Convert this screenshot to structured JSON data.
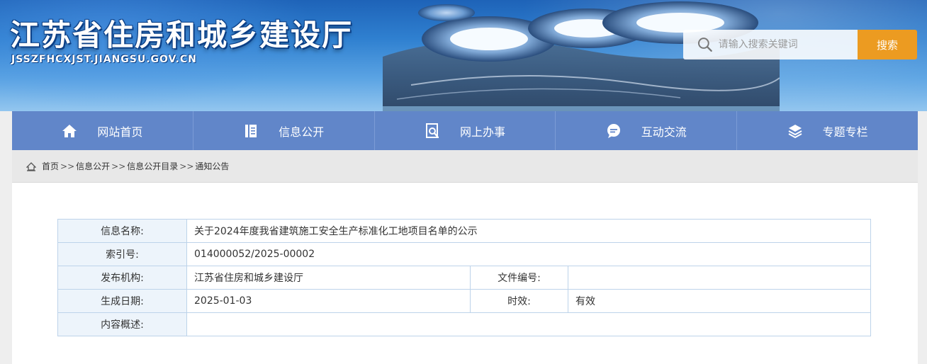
{
  "header": {
    "site_title": "江苏省住房和城乡建设厅",
    "site_url": "JSSZFHCXJST.JIANGSU.GOV.CN",
    "search": {
      "placeholder": "请输入搜索关键词",
      "button_label": "搜索"
    }
  },
  "nav": {
    "items": [
      {
        "label": "网站首页",
        "icon": "home-icon"
      },
      {
        "label": "信息公开",
        "icon": "document-icon"
      },
      {
        "label": "网上办事",
        "icon": "search-document-icon"
      },
      {
        "label": "互动交流",
        "icon": "chat-icon"
      },
      {
        "label": "专题专栏",
        "icon": "layers-icon"
      }
    ]
  },
  "breadcrumb": {
    "items": [
      "首页",
      "信息公开",
      "信息公开目录",
      "通知公告"
    ],
    "separator": ">>"
  },
  "info": {
    "name_label": "信息名称:",
    "name_value": "关于2024年度我省建筑施工安全生产标准化工地项目名单的公示",
    "index_label": "索引号:",
    "index_value": "014000052/2025-00002",
    "publisher_label": "发布机构:",
    "publisher_value": "江苏省住房和城乡建设厅",
    "doc_number_label": "文件编号:",
    "doc_number_value": "",
    "date_label": "生成日期:",
    "date_value": "2025-01-03",
    "validity_label": "时效:",
    "validity_value": "有效",
    "summary_label": "内容概述:",
    "summary_value": ""
  },
  "colors": {
    "nav_bg": "#6186c9",
    "search_button": "#ec9b21",
    "label_bg": "#edf4fb",
    "table_border": "#bdd3ea"
  }
}
